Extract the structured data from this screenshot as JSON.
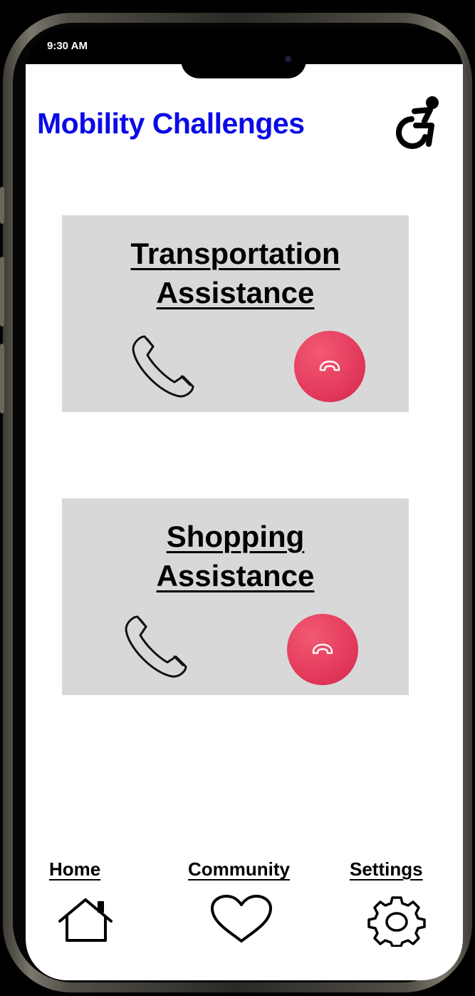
{
  "status_bar": {
    "time": "9:30 AM"
  },
  "header": {
    "title": "Mobility Challenges",
    "icon": "wheelchair-accessibility-icon"
  },
  "cards": [
    {
      "title_line1": "Transportation",
      "title_line2": "Assistance",
      "call_icon": "phone-icon",
      "end_icon": "hang-up-icon"
    },
    {
      "title_line1": "Shopping",
      "title_line2": "Assistance",
      "call_icon": "phone-icon",
      "end_icon": "hang-up-icon"
    }
  ],
  "nav": {
    "home": {
      "label": "Home",
      "icon": "house-icon"
    },
    "community": {
      "label": "Community",
      "icon": "heart-icon"
    },
    "settings": {
      "label": "Settings",
      "icon": "gear-icon"
    }
  },
  "colors": {
    "title": "#0a0ae6",
    "card_bg": "#d8d8d8",
    "end_call": "#e43a5c"
  }
}
